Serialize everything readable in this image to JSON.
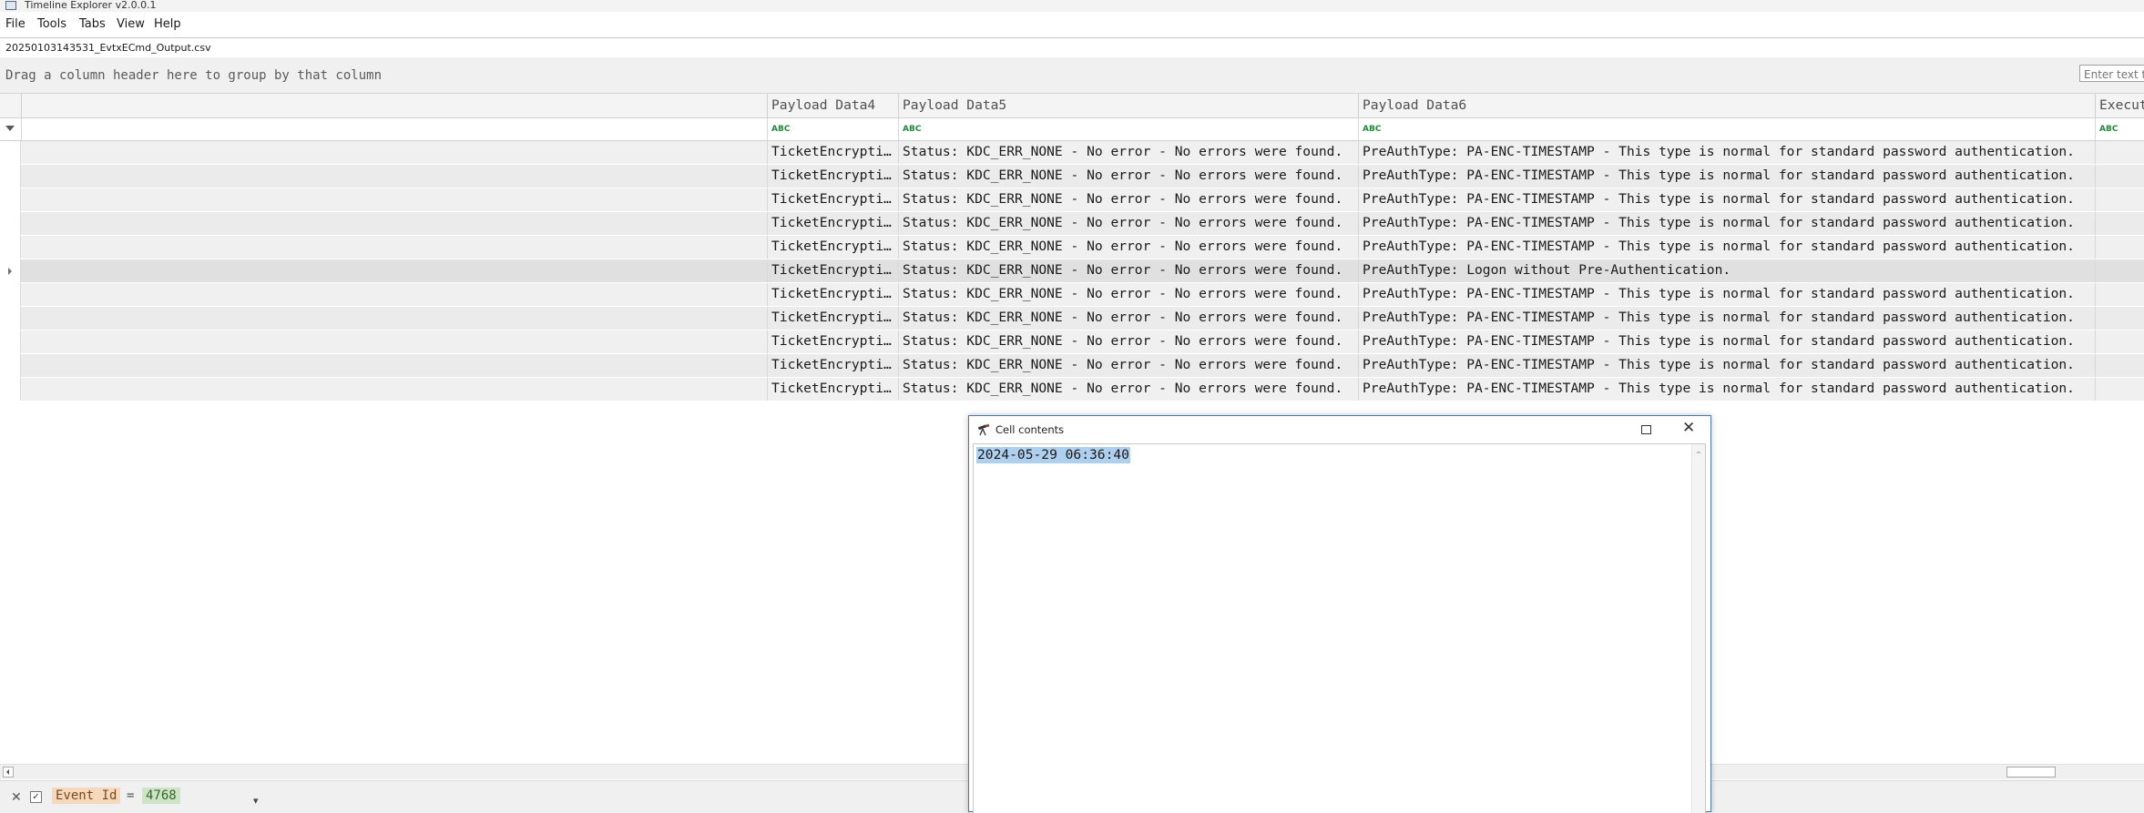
{
  "window": {
    "title": "Timeline Explorer v2.0.0.1"
  },
  "menu": {
    "items": [
      "File",
      "Tools",
      "Tabs",
      "View",
      "Help"
    ]
  },
  "tab": {
    "label": "20250103143531_EvtxECmd_Output.csv"
  },
  "grouping": {
    "hint": "Drag a column header here to group by that column"
  },
  "search": {
    "placeholder": "Enter text to search"
  },
  "grid": {
    "columns": [
      "",
      "Payload Data4",
      "Payload Data5",
      "Payload Data6",
      "Execut"
    ],
    "filter_icon_text": "ABC",
    "rows": [
      {
        "data4": "TicketEncrypti…",
        "data5": "Status: KDC_ERR_NONE - No error - No errors were found.",
        "data6": "PreAuthType: PA-ENC-TIMESTAMP - This type is normal for standard password authentication."
      },
      {
        "data4": "TicketEncrypti…",
        "data5": "Status: KDC_ERR_NONE - No error - No errors were found.",
        "data6": "PreAuthType: PA-ENC-TIMESTAMP - This type is normal for standard password authentication."
      },
      {
        "data4": "TicketEncrypti…",
        "data5": "Status: KDC_ERR_NONE - No error - No errors were found.",
        "data6": "PreAuthType: PA-ENC-TIMESTAMP - This type is normal for standard password authentication."
      },
      {
        "data4": "TicketEncrypti…",
        "data5": "Status: KDC_ERR_NONE - No error - No errors were found.",
        "data6": "PreAuthType: PA-ENC-TIMESTAMP - This type is normal for standard password authentication."
      },
      {
        "data4": "TicketEncrypti…",
        "data5": "Status: KDC_ERR_NONE - No error - No errors were found.",
        "data6": "PreAuthType: PA-ENC-TIMESTAMP - This type is normal for standard password authentication."
      },
      {
        "data4": "TicketEncrypti…",
        "data5": "Status: KDC_ERR_NONE - No error - No errors were found.",
        "data6": "PreAuthType: Logon without Pre-Authentication."
      },
      {
        "data4": "TicketEncrypti…",
        "data5": "Status: KDC_ERR_NONE - No error - No errors were found.",
        "data6": "PreAuthType: PA-ENC-TIMESTAMP - This type is normal for standard password authentication."
      },
      {
        "data4": "TicketEncrypti…",
        "data5": "Status: KDC_ERR_NONE - No error - No errors were found.",
        "data6": "PreAuthType: PA-ENC-TIMESTAMP - This type is normal for standard password authentication."
      },
      {
        "data4": "TicketEncrypti…",
        "data5": "Status: KDC_ERR_NONE - No error - No errors were found.",
        "data6": "PreAuthType: PA-ENC-TIMESTAMP - This type is normal for standard password authentication."
      },
      {
        "data4": "TicketEncrypti…",
        "data5": "Status: KDC_ERR_NONE - No error - No errors were found.",
        "data6": "PreAuthType: PA-ENC-TIMESTAMP - This type is normal for standard password authentication."
      },
      {
        "data4": "TicketEncrypti…",
        "data5": "Status: KDC_ERR_NONE - No error - No errors were found.",
        "data6": "PreAuthType: PA-ENC-TIMESTAMP - This type is normal for standard password authentication."
      }
    ]
  },
  "filter": {
    "field": "Event Id",
    "operator": "=",
    "value": "4768",
    "checked": true
  },
  "dialog": {
    "title": "Cell contents",
    "text": "2024-05-29 06:36:40"
  },
  "colors": {
    "selection": "#aecfee",
    "filter_field": "#f6d9bd",
    "filter_value": "#cfe3c6",
    "dialog_border": "#4d78a8"
  },
  "icons": [
    "app-icon",
    "funnel-icon",
    "abc-filter-icon",
    "row-indicator-icon",
    "telescope-icon",
    "maximize-icon",
    "close-icon",
    "clear-filter-icon",
    "dropdown-icon"
  ]
}
